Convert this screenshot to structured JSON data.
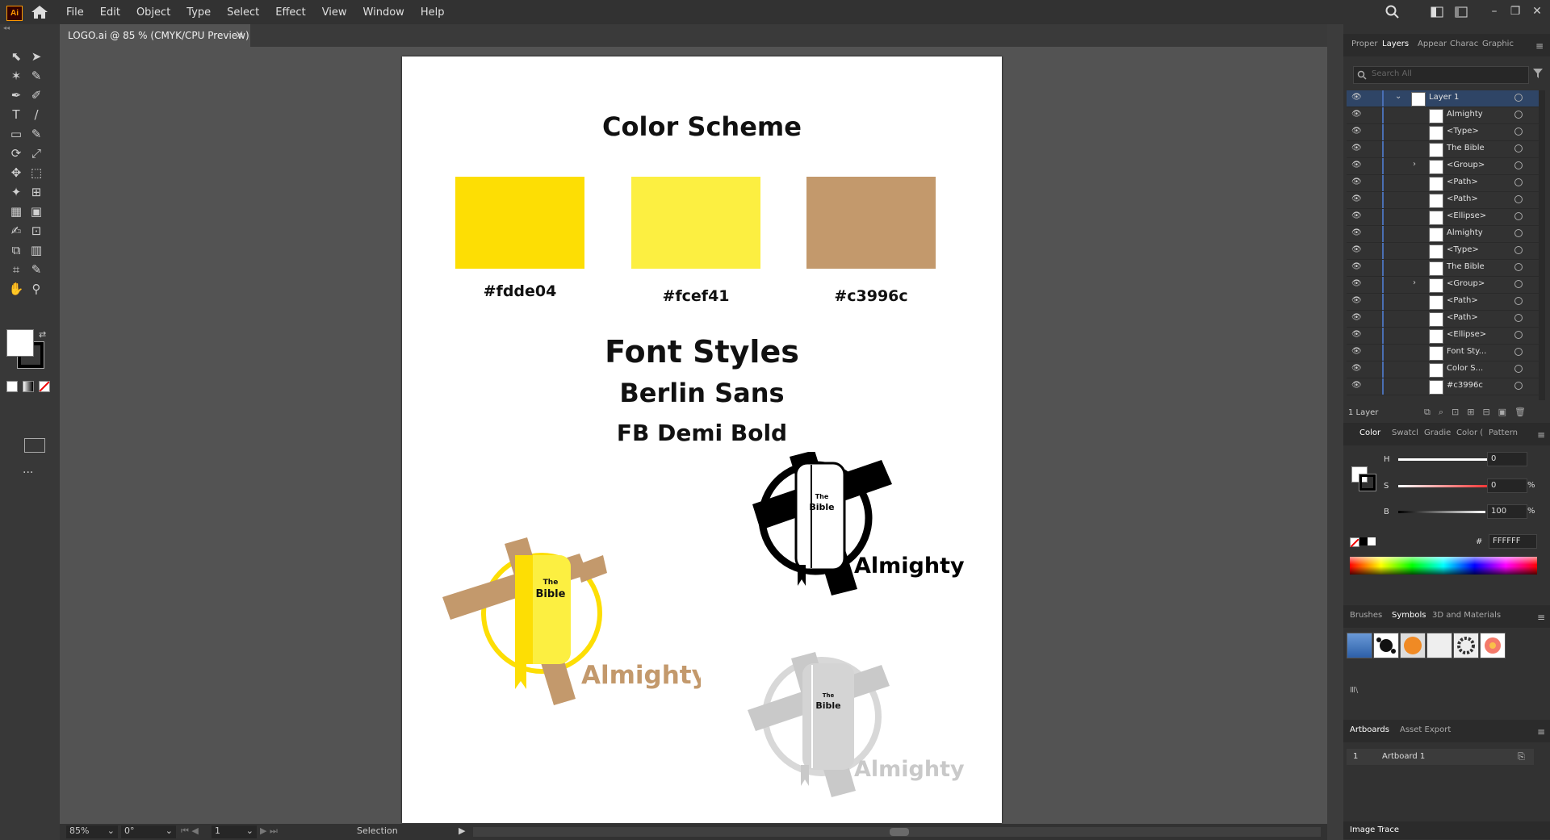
{
  "app": {
    "logo": "Ai",
    "menus": [
      "File",
      "Edit",
      "Object",
      "Type",
      "Select",
      "Effect",
      "View",
      "Window",
      "Help"
    ]
  },
  "document_tab": {
    "title": "LOGO.ai @ 85 % (CMYK/CPU Preview)",
    "close": "×"
  },
  "artboard": {
    "color_title": "Color Scheme",
    "swatches": [
      {
        "hex": "#fdde04",
        "label": "#fdde04"
      },
      {
        "hex": "#fcef41",
        "label": "#fcef41"
      },
      {
        "hex": "#c3996c",
        "label": "#c3996c"
      }
    ],
    "font_title": "Font Styles",
    "font_name1": "Berlin Sans",
    "font_name2": "FB Demi Bold",
    "logo_the": "The",
    "logo_bible": "Bible",
    "logo_almighty": "Almighty"
  },
  "status": {
    "zoom": "85%",
    "rotation": "0°",
    "page": "1",
    "tool": "Selection"
  },
  "panels": {
    "top_tabs": [
      "Proper",
      "Layers",
      "Appear",
      "Charac",
      "Graphic"
    ],
    "active_top_tab": "Layers",
    "search_placeholder": "Search All",
    "layers": [
      {
        "name": "Layer 1",
        "level": 0,
        "expand": true
      },
      {
        "name": "Almighty",
        "level": 1
      },
      {
        "name": "<Type>",
        "level": 1
      },
      {
        "name": "The  Bible",
        "level": 1
      },
      {
        "name": "<Group>",
        "level": 1,
        "expand": true
      },
      {
        "name": "<Path>",
        "level": 1
      },
      {
        "name": "<Path>",
        "level": 1
      },
      {
        "name": "<Ellipse>",
        "level": 1
      },
      {
        "name": "Almighty",
        "level": 1
      },
      {
        "name": "<Type>",
        "level": 1
      },
      {
        "name": "The  Bible",
        "level": 1
      },
      {
        "name": "<Group>",
        "level": 1,
        "expand": true
      },
      {
        "name": "<Path>",
        "level": 1
      },
      {
        "name": "<Path>",
        "level": 1
      },
      {
        "name": "<Ellipse>",
        "level": 1
      },
      {
        "name": "Font Sty...",
        "level": 1
      },
      {
        "name": "Color S...",
        "level": 1
      },
      {
        "name": "#c3996c",
        "level": 1
      }
    ],
    "layer_count": "1 Layer",
    "color_tabs": [
      "Color",
      "Swatcl",
      "Gradie",
      "Color (",
      "Pattern"
    ],
    "hsb": {
      "h_label": "H",
      "h": "0",
      "s_label": "S",
      "s": "0",
      "b_label": "B",
      "b": "100",
      "pct": "%"
    },
    "hex_value": "FFFFFF",
    "hash": "#",
    "brush_tabs": [
      "Brushes",
      "Symbols",
      "3D and Materials"
    ],
    "artboard_tabs": [
      "Artboards",
      "Asset Export"
    ],
    "artboard_row": {
      "num": "1",
      "name": "Artboard 1"
    },
    "image_trace": "Image Trace"
  },
  "colors": {
    "yellow": "#fdde04",
    "lightyellow": "#fcef41",
    "tan": "#c3996c",
    "accent": "#4a6fb3"
  }
}
